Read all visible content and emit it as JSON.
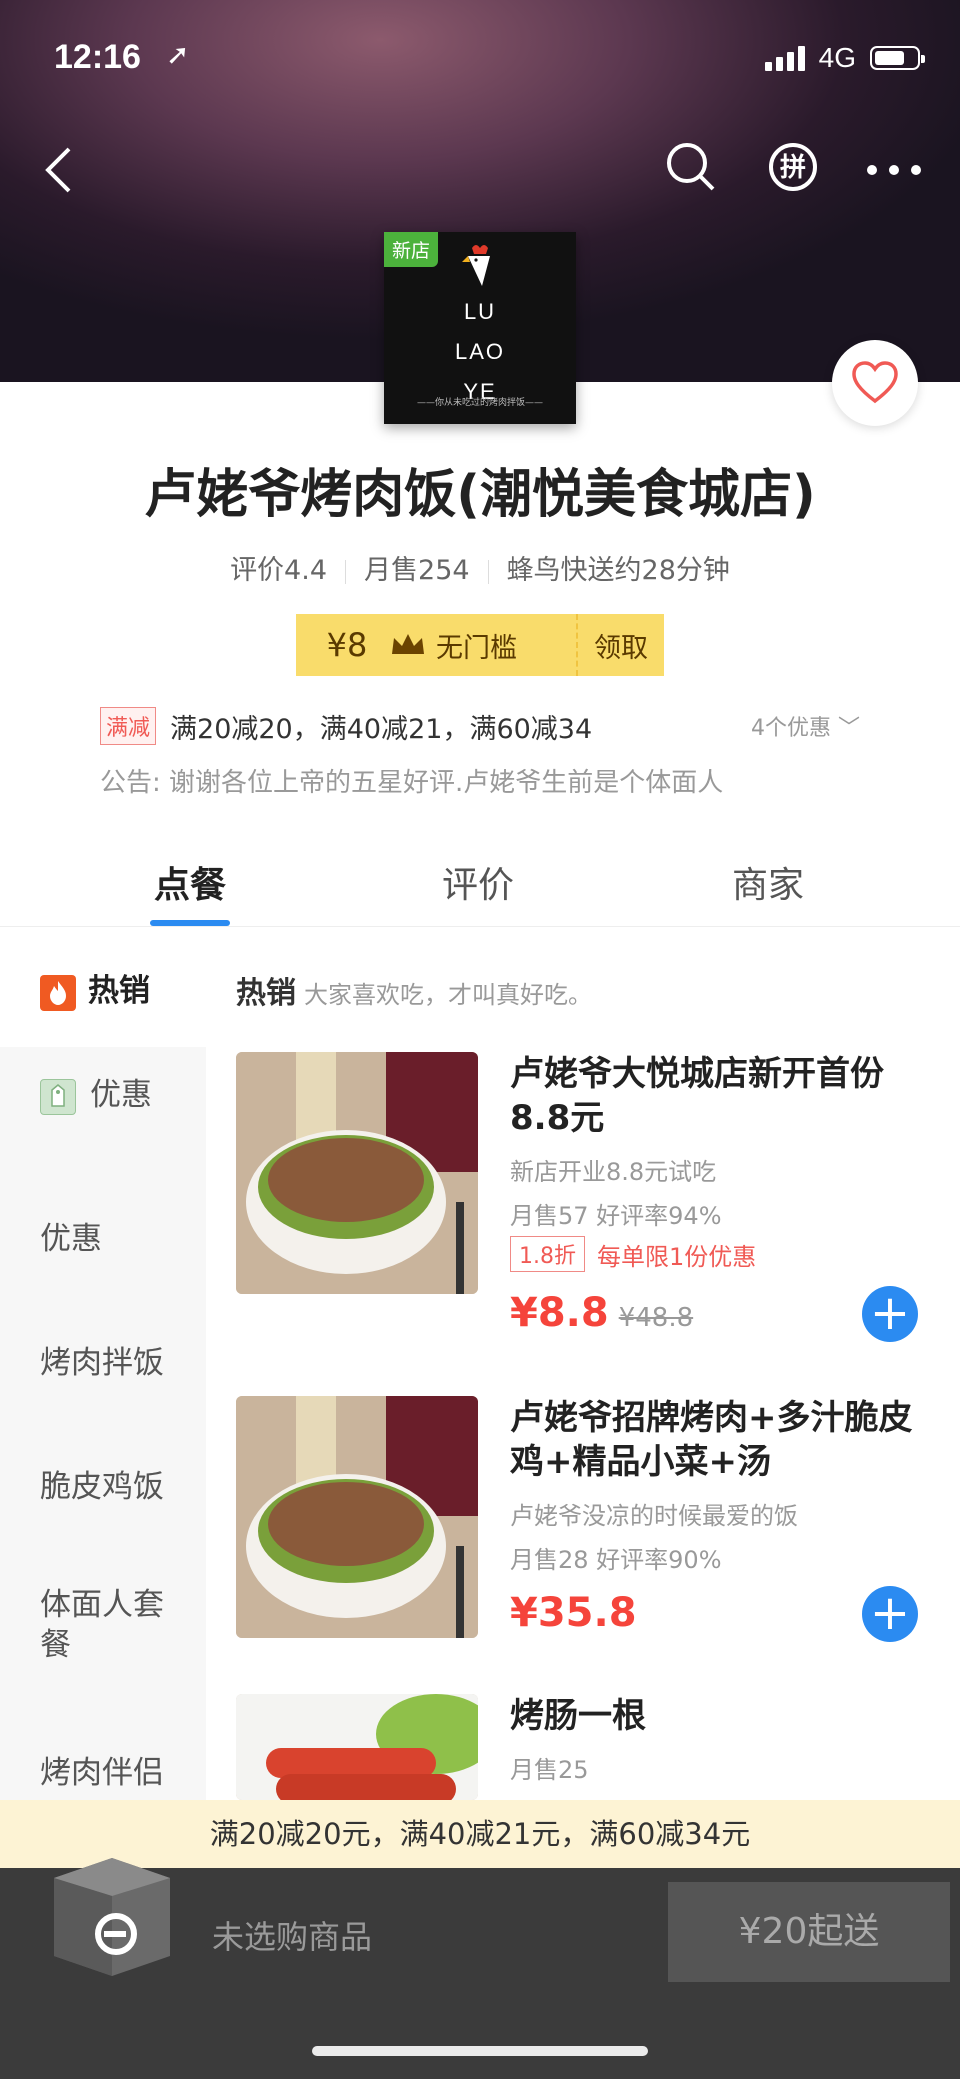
{
  "status": {
    "time": "12:16",
    "network": "4G"
  },
  "shop": {
    "logo_badge": "新店",
    "logo_lines": [
      "LU",
      "LAO",
      "YE"
    ],
    "logo_tagline": "——你从未吃过的烤肉拌饭——",
    "name": "卢姥爷烤肉饭(潮悦美食城店)",
    "rating": "评价4.4",
    "monthly_sales": "月售254",
    "delivery": "蜂鸟快送约28分钟"
  },
  "coupon": {
    "amount": "¥8",
    "condition": "无门槛",
    "action": "领取"
  },
  "promo": {
    "tag": "满减",
    "text": "满20减20，满40减21，满60减34",
    "count": "4个优惠"
  },
  "notice": "公告: 谢谢各位上帝的五星好评.卢姥爷生前是个体面人",
  "tabs": [
    "点餐",
    "评价",
    "商家"
  ],
  "sidebar": [
    "热销",
    "优惠",
    "优惠",
    "烤肉拌饭",
    "脆皮鸡饭",
    "体面人套餐",
    "烤肉伴侣"
  ],
  "section": {
    "title": "热销",
    "subtitle": "大家喜欢吃，才叫真好吃。"
  },
  "products": [
    {
      "title": "卢姥爷大悦城店新开首份8.8元",
      "sub": "新店开业8.8元试吃",
      "stats": "月售57  好评率94%",
      "discount": "1.8折",
      "limit": "每单限1份优惠",
      "price": "¥8.8",
      "old_price": "¥48.8"
    },
    {
      "title": "卢姥爷招牌烤肉+多汁脆皮鸡+精品小菜+汤",
      "sub": "卢姥爷没凉的时候最爱的饭",
      "stats": "月售28  好评率90%",
      "price": "¥35.8"
    },
    {
      "title": "烤肠一根",
      "stats": "月售25"
    }
  ],
  "tipbar": "满20减20元，满40减21元，满60减34元",
  "cart": {
    "empty": "未选购商品",
    "min_order": "¥20起送"
  },
  "colors": {
    "accent": "#2b8bf1",
    "price": "#f5443b",
    "coupon": "#f9dc6b"
  }
}
